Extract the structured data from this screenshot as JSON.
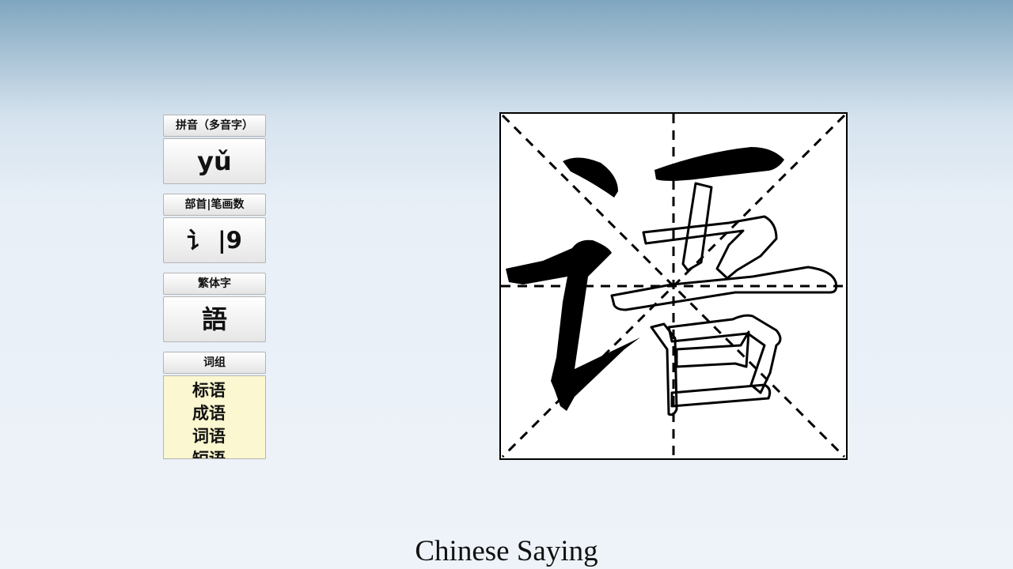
{
  "pinyin": {
    "label": "拼音（多音字）",
    "value": "yǔ"
  },
  "radical_strokes": {
    "label": "部首|笔画数",
    "value": "讠 |9"
  },
  "traditional": {
    "label": "繁体字",
    "value": "語"
  },
  "words": {
    "label": "词组",
    "items": [
      "标语",
      "成语",
      "词语",
      "短语"
    ]
  },
  "caption": "Chinese Saying",
  "colors": {
    "word_box_bg": "#fbf7d0",
    "ink": "#000000",
    "grid_bg": "#ffffff"
  }
}
